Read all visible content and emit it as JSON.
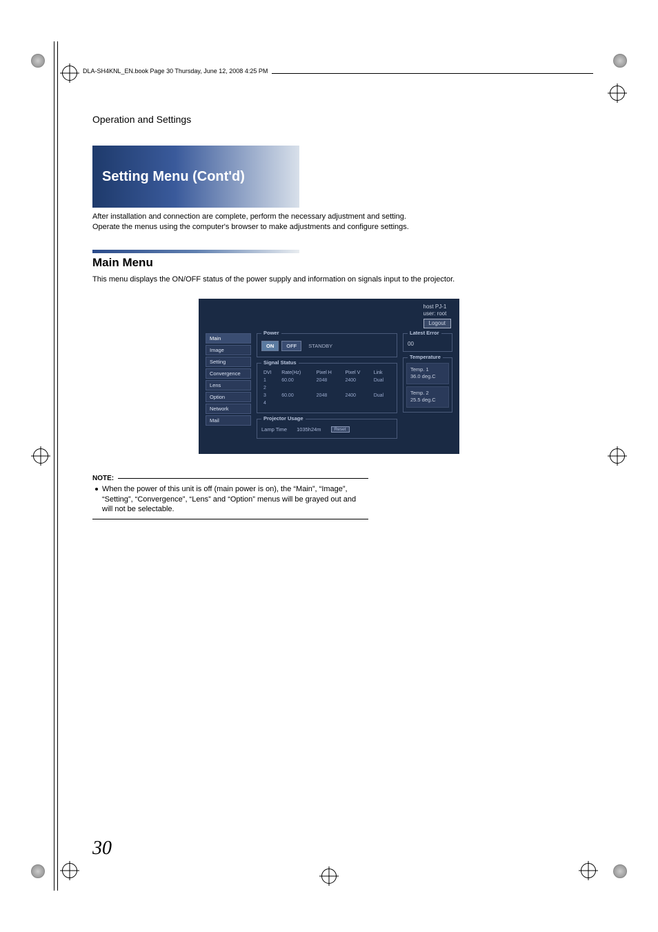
{
  "doc_header": "DLA-SH4KNL_EN.book  Page 30  Thursday, June 12, 2008  4:25 PM",
  "section_title": "Operation and Settings",
  "banner": "Setting Menu (Cont'd)",
  "intro_line1": "After installation and connection are complete, perform the necessary adjustment and setting.",
  "intro_line2": "Operate the menus using the computer's browser to make adjustments and configure settings.",
  "subhead": "Main Menu",
  "subdesc": "This menu displays the ON/OFF status of the power supply and information on signals input to the projector.",
  "panel": {
    "host": "host PJ-1",
    "user": "user: root",
    "logout": "Logout",
    "sidebar": [
      "Main",
      "Image",
      "Setting",
      "Convergence",
      "Lens",
      "Option",
      "Network",
      "Mail"
    ],
    "power": {
      "legend": "Power",
      "on": "ON",
      "off": "OFF",
      "standby": "STANDBY"
    },
    "signal": {
      "legend": "Signal Status",
      "headers": [
        "DVI",
        "Rate(Hz)",
        "Pixel H",
        "Pixel V",
        "Link"
      ],
      "rows": [
        {
          "n": "1",
          "rate": "60.00",
          "ph": "2048",
          "pv": "2400",
          "link": "Dual"
        },
        {
          "n": "2",
          "rate": "",
          "ph": "",
          "pv": "",
          "link": ""
        },
        {
          "n": "3",
          "rate": "60.00",
          "ph": "2048",
          "pv": "2400",
          "link": "Dual"
        },
        {
          "n": "4",
          "rate": "",
          "ph": "",
          "pv": "",
          "link": ""
        }
      ]
    },
    "usage": {
      "legend": "Projector Usage",
      "lamp_label": "Lamp Time",
      "lamp_value": "1035h24m",
      "reset": "Reset"
    },
    "error": {
      "legend": "Latest Error",
      "value": "00"
    },
    "temperature": {
      "legend": "Temperature",
      "t1_label": "Temp. 1",
      "t1_value": "36.0 deg.C",
      "t2_label": "Temp. 2",
      "t2_value": "25.5 deg.C"
    }
  },
  "note": {
    "head": "NOTE:",
    "body": "When the power of this unit is off (main power is on), the “Main”, “Image”, “Setting”, “Convergence”, “Lens” and “Option” menus will be grayed out and will not be selectable."
  },
  "page_number": "30"
}
